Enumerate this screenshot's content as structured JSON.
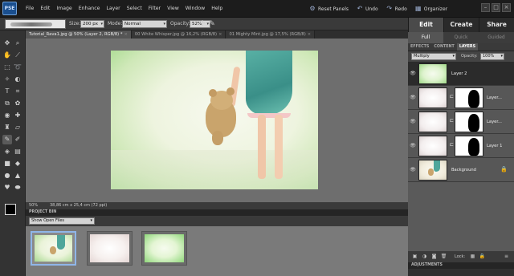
{
  "app": {
    "logo_text": "PSE"
  },
  "menu": [
    "File",
    "Edit",
    "Image",
    "Enhance",
    "Layer",
    "Select",
    "Filter",
    "View",
    "Window",
    "Help"
  ],
  "top_actions": {
    "reset_panels": "Reset Panels",
    "undo": "Undo",
    "redo": "Redo",
    "organizer": "Organizer"
  },
  "window_buttons": [
    "–",
    "□",
    "×"
  ],
  "mode_tabs": {
    "edit": "Edit",
    "create": "Create",
    "share": "Share"
  },
  "edit_subtabs": {
    "full": "Full",
    "quick": "Quick",
    "guided": "Guided"
  },
  "options": {
    "size_label": "Size:",
    "size_value": "200 px",
    "mode_label": "Mode:",
    "mode_value": "Normal",
    "opacity_label": "Opacity:",
    "opacity_value": "52%"
  },
  "doc_tabs": [
    {
      "label": "Tutorial_Rava1.jpg @ 50% (Layer 2, RGB/8) *",
      "active": true
    },
    {
      "label": "00 White Whisper.jpg @ 16,2% (RGB/8)",
      "active": false
    },
    {
      "label": "01 Mighty Mint.jpg @ 17,5% (RGB/8)",
      "active": false
    }
  ],
  "tool_icons": [
    "move-icon",
    "zoom-icon",
    "hand-icon",
    "eyedropper-icon",
    "marquee-icon",
    "lasso-icon",
    "magic-wand-icon",
    "quick-select-icon",
    "type-icon",
    "crop-icon",
    "recompose-icon",
    "cookie-cutter-icon",
    "red-eye-icon",
    "spot-healing-icon",
    "clone-stamp-icon",
    "eraser-icon",
    "brush-icon",
    "smart-brush-icon",
    "paint-bucket-icon",
    "gradient-icon",
    "shape-icon",
    "blur-icon",
    "sponge-icon",
    "straighten-icon",
    "custom-shape-icon",
    "burn-icon"
  ],
  "status": {
    "zoom": "50%",
    "doc_size": "38,86 cm x 25,4 cm (72 ppi)"
  },
  "project_bin": {
    "title": "PROJECT BIN",
    "show": "Show Open Files"
  },
  "panels": {
    "tabs": [
      "EFFECTS",
      "CONTENT",
      "LAYERS"
    ],
    "blend_mode": "Multiply",
    "opacity_label": "Opacity:",
    "opacity_value": "100%",
    "lock_label": "Lock:",
    "adjustments_title": "ADJUSTMENTS"
  },
  "layers": [
    {
      "name": "Layer 2"
    },
    {
      "name": "Layer..."
    },
    {
      "name": "Layer..."
    },
    {
      "name": "Layer 1"
    },
    {
      "name": "Background"
    }
  ],
  "colors": {
    "accent_blue": "#8fb6e8",
    "mint": "#9fd887",
    "panel_dark": "#2b2b2b"
  }
}
